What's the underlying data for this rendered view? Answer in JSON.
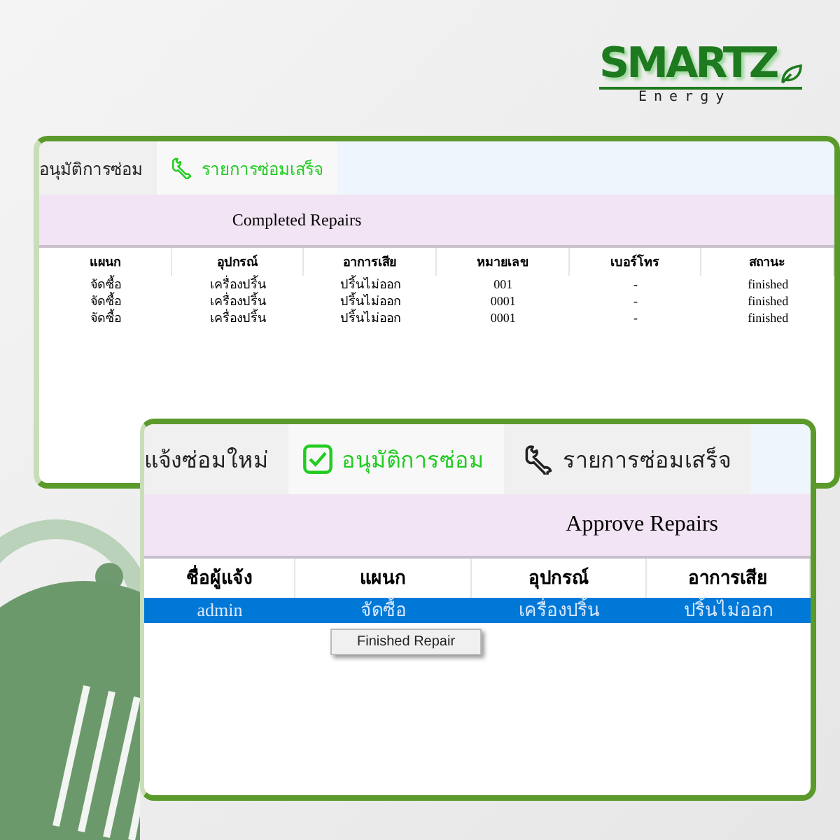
{
  "logo": {
    "name": "SMARTZ",
    "tagline": "Energy"
  },
  "completed_window": {
    "tabs": [
      {
        "label": "อนุมัติการซ่อม",
        "kind": "plain",
        "selected": false
      },
      {
        "label": "รายการซ่อมเสร็จ",
        "kind": "wrench",
        "selected": true
      }
    ],
    "title": "Completed Repairs",
    "columns": [
      "แผนก",
      "อุปกรณ์",
      "อาการเสีย",
      "หมายเลข",
      "เบอร์โทร",
      "สถานะ"
    ],
    "rows": [
      [
        "จัดซื้อ",
        "เครื่องปริ้น",
        "ปริ้นไม่ออก",
        "001",
        "-",
        "finished"
      ],
      [
        "จัดซื้อ",
        "เครื่องปริ้น",
        "ปริ้นไม่ออก",
        "0001",
        "-",
        "finished"
      ],
      [
        "จัดซื้อ",
        "เครื่องปริ้น",
        "ปริ้นไม่ออก",
        "0001",
        "-",
        "finished"
      ]
    ]
  },
  "approve_window": {
    "tabs": [
      {
        "label": "แจ้งซ่อมใหม่",
        "kind": "plain",
        "selected": false
      },
      {
        "label": "อนุมัติการซ่อม",
        "kind": "check",
        "selected": true
      },
      {
        "label": "รายการซ่อมเสร็จ",
        "kind": "wrench",
        "selected": false
      }
    ],
    "title": "Approve Repairs",
    "columns": [
      "ชื่อผู้แจ้ง",
      "แผนก",
      "อุปกรณ์",
      "อาการเสีย"
    ],
    "rows": [
      {
        "cells": [
          "admin",
          "จัดซื้อ",
          "เครื่องปริ้น",
          "ปริ้นไม่ออก"
        ],
        "selected": true
      }
    ],
    "context_menu": {
      "items": [
        "Finished Repair"
      ]
    }
  }
}
